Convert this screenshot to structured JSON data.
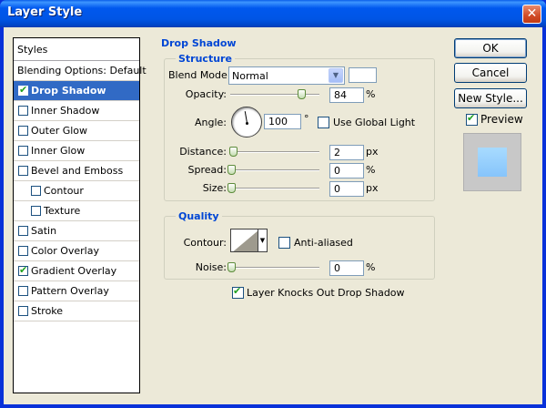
{
  "window": {
    "title": "Layer Style",
    "close_glyph": "✕"
  },
  "styles_panel": {
    "header": "Styles",
    "items": [
      {
        "label": "Blending Options: Default",
        "checkbox": false,
        "checked": false,
        "selected": false
      },
      {
        "label": "Drop Shadow",
        "checkbox": true,
        "checked": true,
        "selected": true
      },
      {
        "label": "Inner Shadow",
        "checkbox": true,
        "checked": false,
        "selected": false
      },
      {
        "label": "Outer Glow",
        "checkbox": true,
        "checked": false,
        "selected": false
      },
      {
        "label": "Inner Glow",
        "checkbox": true,
        "checked": false,
        "selected": false
      },
      {
        "label": "Bevel and Emboss",
        "checkbox": true,
        "checked": false,
        "selected": false
      },
      {
        "label": "Contour",
        "checkbox": true,
        "checked": false,
        "selected": false,
        "sub": true
      },
      {
        "label": "Texture",
        "checkbox": true,
        "checked": false,
        "selected": false,
        "sub": true
      },
      {
        "label": "Satin",
        "checkbox": true,
        "checked": false,
        "selected": false
      },
      {
        "label": "Color Overlay",
        "checkbox": true,
        "checked": false,
        "selected": false
      },
      {
        "label": "Gradient Overlay",
        "checkbox": true,
        "checked": true,
        "selected": false
      },
      {
        "label": "Pattern Overlay",
        "checkbox": true,
        "checked": false,
        "selected": false
      },
      {
        "label": "Stroke",
        "checkbox": true,
        "checked": false,
        "selected": false
      }
    ]
  },
  "drop_shadow": {
    "title": "Drop Shadow",
    "structure": {
      "title": "Structure",
      "blend_mode_label": "Blend Mode:",
      "blend_mode_value": "Normal",
      "shadow_color": "#ffffff",
      "opacity_label": "Opacity:",
      "opacity_value": "84",
      "opacity_unit": "%",
      "opacity_level": 0.84,
      "angle_label": "Angle:",
      "angle_value": "100",
      "angle_unit": "°",
      "use_global_light_label": "Use Global Light",
      "use_global_light_checked": false,
      "distance_label": "Distance:",
      "distance_value": "2",
      "distance_unit": "px",
      "distance_level": 0.02,
      "spread_label": "Spread:",
      "spread_value": "0",
      "spread_unit": "%",
      "spread_level": 0,
      "size_label": "Size:",
      "size_value": "0",
      "size_unit": "px",
      "size_level": 0
    },
    "quality": {
      "title": "Quality",
      "contour_label": "Contour:",
      "anti_aliased_label": "Anti-aliased",
      "anti_aliased_checked": false,
      "noise_label": "Noise:",
      "noise_value": "0",
      "noise_unit": "%",
      "noise_level": 0
    },
    "knockout_label": "Layer Knocks Out Drop Shadow",
    "knockout_checked": true
  },
  "buttons": {
    "ok": "OK",
    "cancel": "Cancel",
    "new_style": "New Style...",
    "preview_label": "Preview",
    "preview_checked": true
  },
  "colors": {
    "selection": "#316ac5",
    "legend": "#0046d5",
    "check": "#21a121"
  }
}
